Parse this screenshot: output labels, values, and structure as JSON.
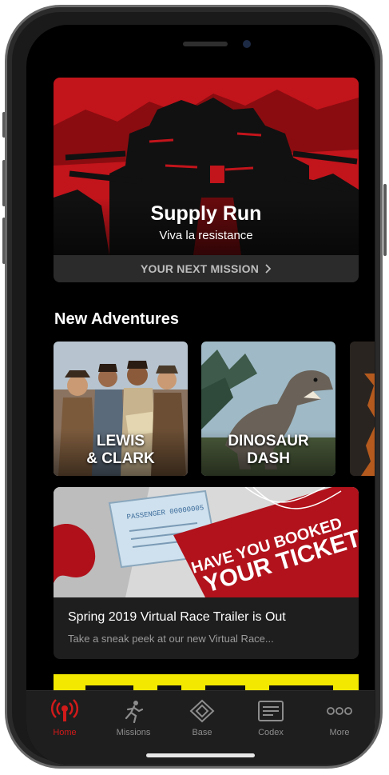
{
  "hero": {
    "title": "Supply Run",
    "subtitle": "Viva la resistance",
    "cta": "YOUR NEXT MISSION",
    "cta_icon": "chevron-right-icon"
  },
  "section": {
    "title": "New Adventures"
  },
  "adventures": [
    {
      "label": "LEWIS\n& CLARK"
    },
    {
      "label": "DINOSAUR\nDASH"
    }
  ],
  "news": {
    "title": "Spring 2019 Virtual Race Trailer is Out",
    "description": "Take a sneak peek at our new Virtual Race...",
    "art_text_1": "HAVE YOU BOOKED",
    "art_text_2": "YOUR TICKET?",
    "ticket_text": "PASSENGER 00000005"
  },
  "tabs": [
    {
      "label": "Home",
      "icon": "radio-signal-icon",
      "active": true
    },
    {
      "label": "Missions",
      "icon": "runner-icon",
      "active": false
    },
    {
      "label": "Base",
      "icon": "base-diamond-icon",
      "active": false
    },
    {
      "label": "Codex",
      "icon": "codex-box-icon",
      "active": false
    },
    {
      "label": "More",
      "icon": "more-dots-icon",
      "active": false
    }
  ],
  "colors": {
    "accent": "#d11a1a",
    "background": "#000000",
    "banner_yellow": "#f2e800"
  }
}
